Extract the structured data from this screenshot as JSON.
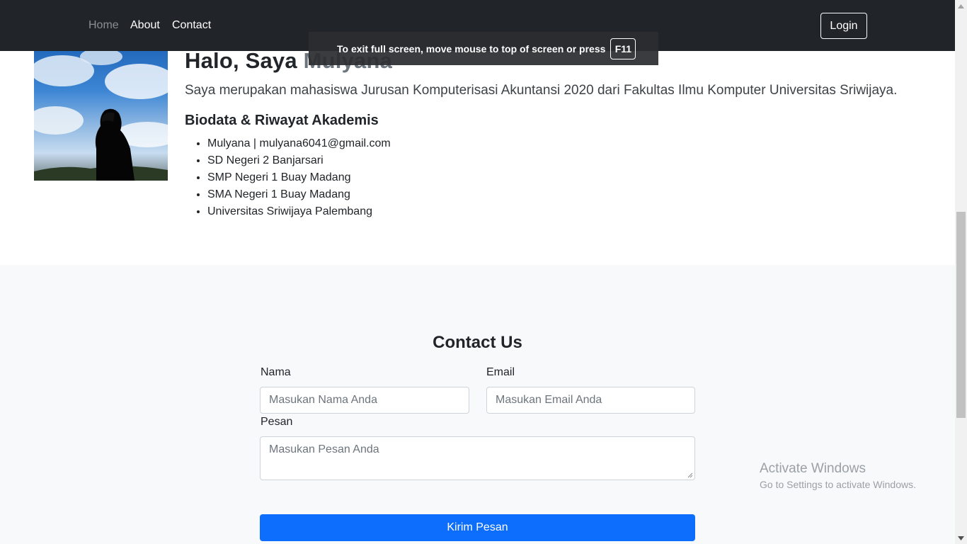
{
  "navbar": {
    "links": [
      "Home",
      "About",
      "Contact"
    ],
    "login_label": "Login"
  },
  "fullscreen_notice": {
    "message": "To exit full screen, move mouse to top of screen or press",
    "key": "F11"
  },
  "profile": {
    "greeting_prefix": "Halo, Saya ",
    "name": "Mulyana",
    "lead": "Saya merupakan mahasiswa Jurusan Komputerisasi Akuntansi 2020 dari Fakultas Ilmu Komputer Universitas Sriwijaya.",
    "bio_title": "Biodata & Riwayat Akademis",
    "bio_items": [
      "Mulyana | mulyana6041@gmail.com",
      "SD Negeri 2 Banjarsari",
      "SMP Negeri 1 Buay Madang",
      "SMA Negeri 1 Buay Madang",
      "Universitas Sriwijaya Palembang"
    ]
  },
  "contact": {
    "title": "Contact Us",
    "name_label": "Nama",
    "name_placeholder": "Masukan Nama Anda",
    "email_label": "Email",
    "email_placeholder": "Masukan Email Anda",
    "message_label": "Pesan",
    "message_placeholder": "Masukan Pesan Anda",
    "submit_label": "Kirim Pesan"
  },
  "watermark": {
    "line1": "Activate Windows",
    "line2": "Go to Settings to activate Windows."
  },
  "colors": {
    "navbar_bg": "#212529",
    "primary_button": "#0d6efd",
    "contact_bg": "#f8f9fa"
  },
  "icons": [
    "scroll-up-arrow-icon",
    "scroll-down-arrow-icon",
    "textarea-resize-grip-icon"
  ]
}
